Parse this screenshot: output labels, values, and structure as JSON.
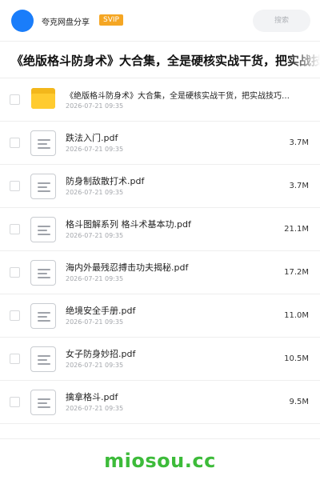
{
  "header": {
    "brand": "夸克网盘分享",
    "badge": "SVIP",
    "search_placeholder": "搜索"
  },
  "title": "《绝版格斗防身术》大合集，全是硬核实战干货，把实战技",
  "files": [
    {
      "type": "folder",
      "icon": "folder-icon",
      "name": "《绝版格斗防身术》大合集，全是硬核实战干货，把实战技巧…",
      "date": "2026-07-21 09:35",
      "size": ""
    },
    {
      "type": "file",
      "icon": "document-icon",
      "name": "跌法入门.pdf",
      "date": "2026-07-21 09:35",
      "size": "3.7M"
    },
    {
      "type": "file",
      "icon": "document-icon",
      "name": "防身制敌散打术.pdf",
      "date": "2026-07-21 09:35",
      "size": "3.7M"
    },
    {
      "type": "file",
      "icon": "document-icon",
      "name": "格斗图解系列 格斗术基本功.pdf",
      "date": "2026-07-21 09:35",
      "size": "21.1M"
    },
    {
      "type": "file",
      "icon": "document-icon",
      "name": "海内外最残忍搏击功夫揭秘.pdf",
      "date": "2026-07-21 09:35",
      "size": "17.2M"
    },
    {
      "type": "file",
      "icon": "document-icon",
      "name": "绝境安全手册.pdf",
      "date": "2026-07-21 09:35",
      "size": "11.0M"
    },
    {
      "type": "file",
      "icon": "document-icon",
      "name": "女子防身妙招.pdf",
      "date": "2026-07-21 09:35",
      "size": "10.5M"
    },
    {
      "type": "file",
      "icon": "document-icon",
      "name": "擒拿格斗.pdf",
      "date": "2026-07-21 09:35",
      "size": "9.5M"
    }
  ],
  "watermark": "miosou.cc",
  "colors": {
    "accent_blue": "#1a7dfa",
    "svip_badge": "#f5a623",
    "folder": "#ffcb2f",
    "watermark": "#3dbb3a"
  }
}
